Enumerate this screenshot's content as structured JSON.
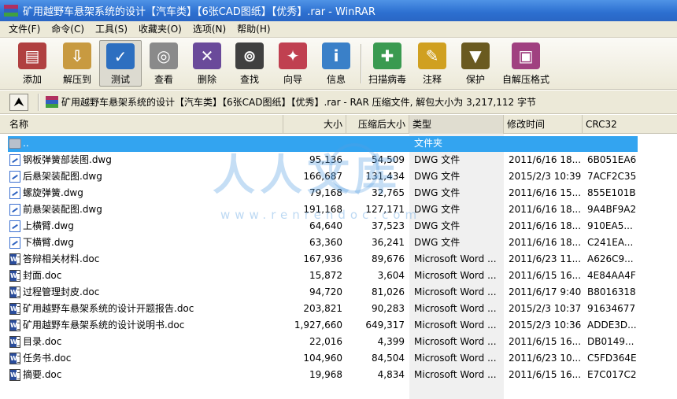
{
  "window": {
    "title": "矿用越野车悬架系统的设计【汽车类】【6张CAD图纸】【优秀】.rar - WinRAR"
  },
  "menu": [
    "文件(F)",
    "命令(C)",
    "工具(S)",
    "收藏夹(O)",
    "选项(N)",
    "帮助(H)"
  ],
  "toolbar": [
    {
      "label": "添加",
      "icon": "add-archive-icon",
      "color": "#b04040"
    },
    {
      "label": "解压到",
      "icon": "extract-to-icon",
      "color": "#c89a40"
    },
    {
      "label": "测试",
      "icon": "test-icon",
      "color": "#2d6fc0"
    },
    {
      "label": "查看",
      "icon": "view-glasses-icon",
      "color": "#8a8a8a"
    },
    {
      "label": "删除",
      "icon": "delete-icon",
      "color": "#6a4a9a"
    },
    {
      "label": "查找",
      "icon": "find-binoculars-icon",
      "color": "#404040"
    },
    {
      "label": "向导",
      "icon": "wizard-icon",
      "color": "#c04050"
    },
    {
      "label": "信息",
      "icon": "info-icon",
      "color": "#3a80c8"
    },
    {
      "label": "扫描病毒",
      "icon": "virus-scan-icon",
      "color": "#3a9a50"
    },
    {
      "label": "注释",
      "icon": "comment-icon",
      "color": "#d0a020"
    },
    {
      "label": "保护",
      "icon": "protect-shield-icon",
      "color": "#6a5a20"
    },
    {
      "label": "自解压格式",
      "icon": "sfx-icon",
      "color": "#a04080"
    }
  ],
  "address": {
    "text": "矿用越野车悬架系统的设计【汽车类】【6张CAD图纸】【优秀】.rar - RAR 压缩文件, 解包大小为 3,217,112 字节"
  },
  "columns": {
    "name": "名称",
    "size": "大小",
    "packed": "压缩后大小",
    "type": "类型",
    "modified": "修改时间",
    "crc": "CRC32"
  },
  "files": [
    {
      "name": "..",
      "size": "",
      "packed": "",
      "type": "文件夹",
      "modified": "",
      "crc": "",
      "kind": "folder"
    },
    {
      "name": "钢板弹簧部装图.dwg",
      "size": "95,136",
      "packed": "54,509",
      "type": "DWG 文件",
      "modified": "2011/6/16 18...",
      "crc": "6B051EA6",
      "kind": "dwg"
    },
    {
      "name": "后悬架装配图.dwg",
      "size": "166,687",
      "packed": "131,434",
      "type": "DWG 文件",
      "modified": "2015/2/3 10:39",
      "crc": "7ACF2C35",
      "kind": "dwg"
    },
    {
      "name": "螺旋弹簧.dwg",
      "size": "79,168",
      "packed": "32,765",
      "type": "DWG 文件",
      "modified": "2011/6/16 15...",
      "crc": "855E101B",
      "kind": "dwg"
    },
    {
      "name": "前悬架装配图.dwg",
      "size": "191,168",
      "packed": "127,171",
      "type": "DWG 文件",
      "modified": "2011/6/16 18...",
      "crc": "9A4BF9A2",
      "kind": "dwg"
    },
    {
      "name": "上横臂.dwg",
      "size": "64,640",
      "packed": "37,523",
      "type": "DWG 文件",
      "modified": "2011/6/16 18...",
      "crc": "910EA5...",
      "kind": "dwg"
    },
    {
      "name": "下横臂.dwg",
      "size": "63,360",
      "packed": "36,241",
      "type": "DWG 文件",
      "modified": "2011/6/16 18...",
      "crc": "C241EA...",
      "kind": "dwg"
    },
    {
      "name": "答辩相关材料.doc",
      "size": "167,936",
      "packed": "89,676",
      "type": "Microsoft Word ...",
      "modified": "2011/6/23 11...",
      "crc": "A626C9...",
      "kind": "doc"
    },
    {
      "name": "封面.doc",
      "size": "15,872",
      "packed": "3,604",
      "type": "Microsoft Word ...",
      "modified": "2011/6/15 16...",
      "crc": "4E84AA4F",
      "kind": "doc"
    },
    {
      "name": "过程管理封皮.doc",
      "size": "94,720",
      "packed": "81,026",
      "type": "Microsoft Word ...",
      "modified": "2011/6/17 9:40",
      "crc": "B8016318",
      "kind": "doc"
    },
    {
      "name": "矿用越野车悬架系统的设计开题报告.doc",
      "size": "203,821",
      "packed": "90,283",
      "type": "Microsoft Word ...",
      "modified": "2015/2/3 10:37",
      "crc": "91634677",
      "kind": "doc"
    },
    {
      "name": "矿用越野车悬架系统的设计说明书.doc",
      "size": "1,927,660",
      "packed": "649,317",
      "type": "Microsoft Word ...",
      "modified": "2015/2/3 10:36",
      "crc": "ADDE3D...",
      "kind": "doc"
    },
    {
      "name": "目录.doc",
      "size": "22,016",
      "packed": "4,399",
      "type": "Microsoft Word ...",
      "modified": "2011/6/15 16...",
      "crc": "DB0149...",
      "kind": "doc"
    },
    {
      "name": "任务书.doc",
      "size": "104,960",
      "packed": "84,504",
      "type": "Microsoft Word ...",
      "modified": "2011/6/23 10...",
      "crc": "C5FD364E",
      "kind": "doc"
    },
    {
      "name": "摘要.doc",
      "size": "19,968",
      "packed": "4,834",
      "type": "Microsoft Word ...",
      "modified": "2011/6/15 16...",
      "crc": "E7C017C2",
      "kind": "doc"
    }
  ],
  "selected_index": 0,
  "watermark": {
    "text": "人人文库",
    "url": "www.renrendoc.com"
  },
  "colors": {
    "selection": "#33a4f0",
    "titlebar": "#2c6fd0",
    "chrome": "#ece9d8"
  }
}
